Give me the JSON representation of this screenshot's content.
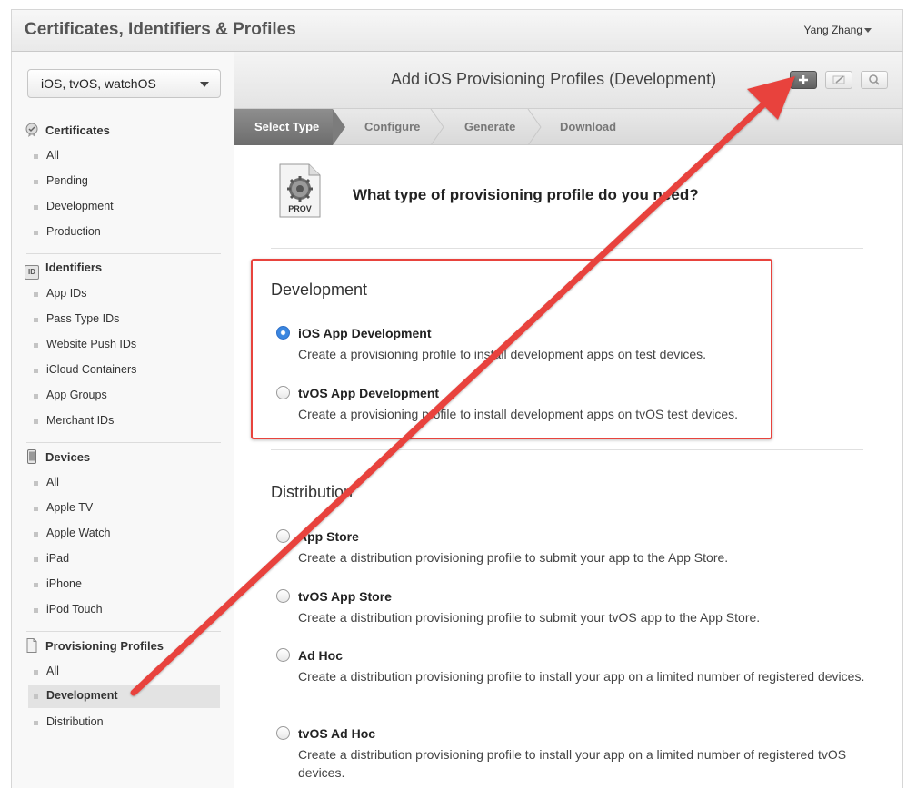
{
  "header": {
    "title": "Certificates, Identifiers & Profiles",
    "user": "Yang Zhang"
  },
  "sidebar": {
    "platform": "iOS, tvOS, watchOS",
    "sections": [
      {
        "label": "Certificates",
        "items": [
          "All",
          "Pending",
          "Development",
          "Production"
        ]
      },
      {
        "label": "Identifiers",
        "items": [
          "App IDs",
          "Pass Type IDs",
          "Website Push IDs",
          "iCloud Containers",
          "App Groups",
          "Merchant IDs"
        ]
      },
      {
        "label": "Devices",
        "items": [
          "All",
          "Apple TV",
          "Apple Watch",
          "iPad",
          "iPhone",
          "iPod Touch"
        ]
      },
      {
        "label": "Provisioning Profiles",
        "items": [
          "All",
          "Development",
          "Distribution"
        ]
      }
    ],
    "active_item": "Development",
    "id_badge": "ID"
  },
  "main": {
    "title": "Add iOS Provisioning Profiles (Development)",
    "steps": [
      "Select Type",
      "Configure",
      "Generate",
      "Download"
    ],
    "icon_label": "PROV",
    "question": "What type of provisioning profile do you need?",
    "groups": [
      {
        "title": "Development",
        "options": [
          {
            "label": "iOS App Development",
            "desc": "Create a provisioning profile to install development apps on test devices.",
            "checked": true
          },
          {
            "label": "tvOS App Development",
            "desc": "Create a provisioning profile to install development apps on tvOS test devices.",
            "checked": false
          }
        ]
      },
      {
        "title": "Distribution",
        "options": [
          {
            "label": "App Store",
            "desc": "Create a distribution provisioning profile to submit your app to the App Store.",
            "checked": false
          },
          {
            "label": "tvOS App Store",
            "desc": "Create a distribution provisioning profile to submit your tvOS app to the App Store.",
            "checked": false
          },
          {
            "label": "Ad Hoc",
            "desc": "Create a distribution provisioning profile to install your app on a limited number of registered devices.",
            "checked": false
          },
          {
            "label": "tvOS Ad Hoc",
            "desc": "Create a distribution provisioning profile to install your app on a limited number of registered tvOS devices.",
            "checked": false
          }
        ]
      }
    ]
  },
  "colors": {
    "annotation": "#e8433d",
    "radio_checked": "#3a86e0"
  }
}
